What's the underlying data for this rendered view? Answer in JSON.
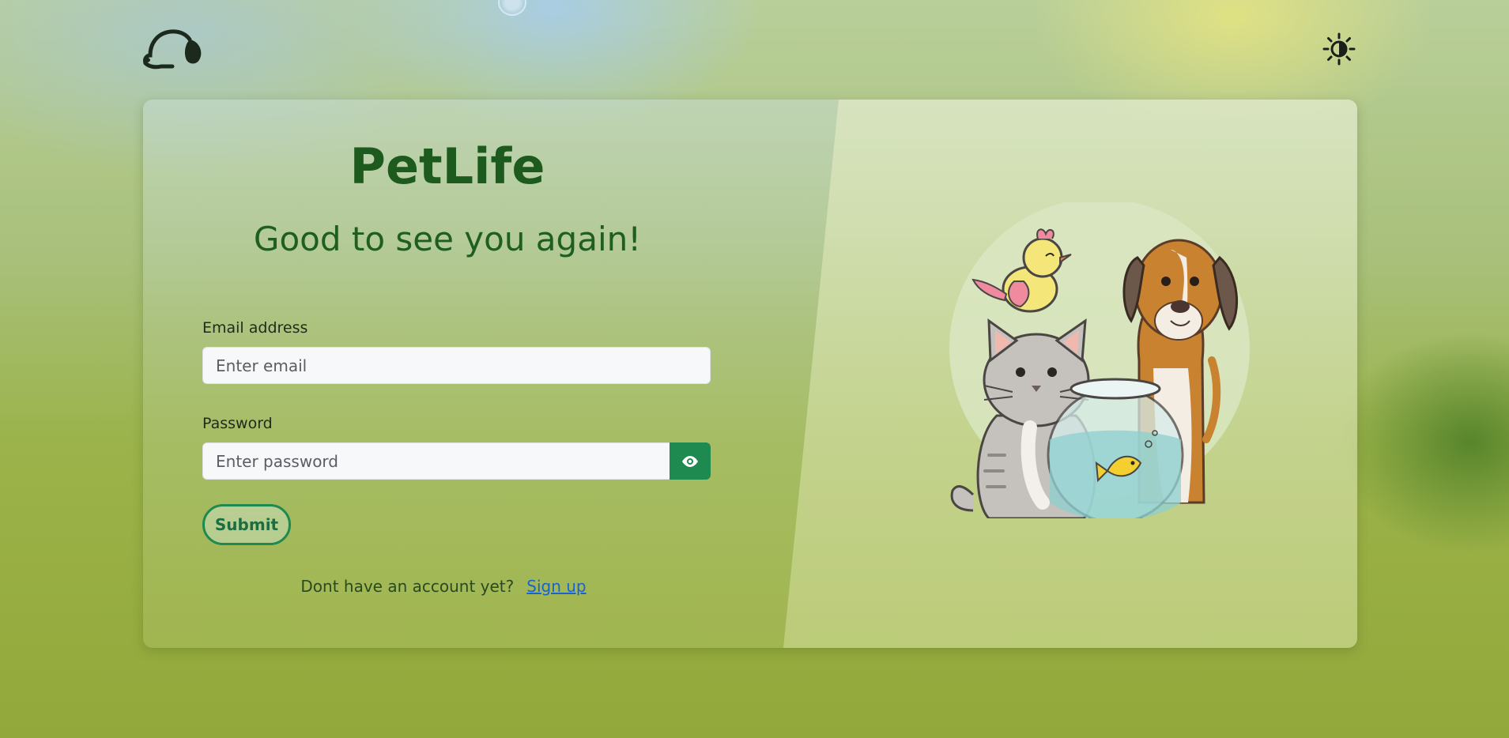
{
  "header": {
    "logo_icon": "dog-head-icon",
    "theme_toggle_icon": "sun-contrast-icon"
  },
  "login": {
    "brand": "PetLife",
    "greeting": "Good to see you again!",
    "email_label": "Email address",
    "email_placeholder": "Enter email",
    "password_label": "Password",
    "password_placeholder": "Enter password",
    "show_password_icon": "eye-icon",
    "submit_label": "Submit",
    "signup_prompt": "Dont have an account yet?",
    "signup_link": "Sign up"
  },
  "illustration": {
    "subject": "pets-illustration",
    "elements": [
      "cat",
      "dog",
      "bird",
      "fishbowl",
      "goldfish"
    ]
  },
  "colors": {
    "accent": "#1e8a4f",
    "brand_text": "#1c5a1e",
    "link": "#1a62cc"
  }
}
